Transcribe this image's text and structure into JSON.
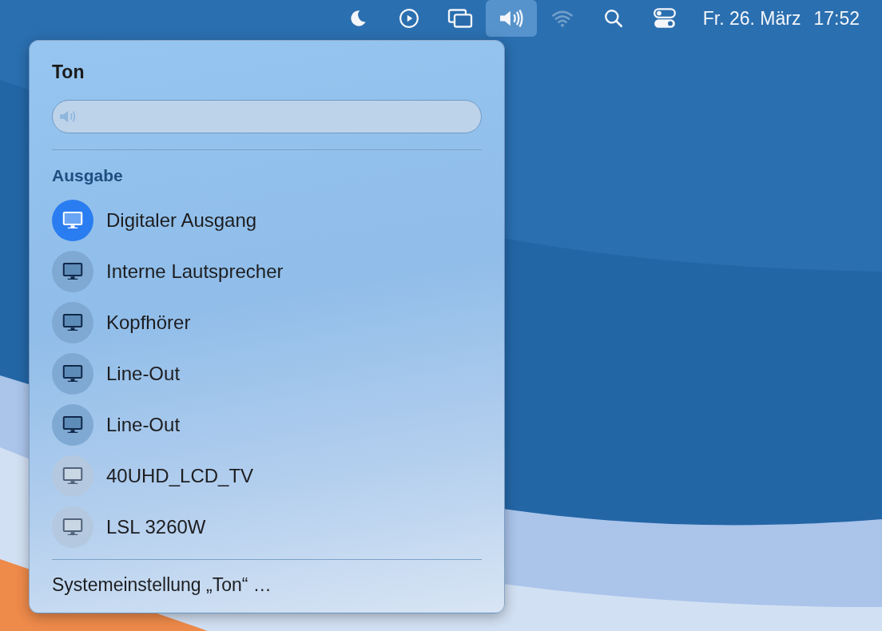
{
  "menu_bar": {
    "items": [
      {
        "kind": "moon",
        "selected": false,
        "disabled": false
      },
      {
        "kind": "play",
        "selected": false,
        "disabled": false
      },
      {
        "kind": "screens",
        "selected": false,
        "disabled": false
      },
      {
        "kind": "speaker",
        "selected": true,
        "disabled": false
      },
      {
        "kind": "wifi",
        "selected": false,
        "disabled": true
      },
      {
        "kind": "search",
        "selected": false,
        "disabled": false
      },
      {
        "kind": "toggles",
        "selected": false,
        "disabled": false
      }
    ],
    "date": "Fr. 26. März",
    "time": "17:52"
  },
  "sound_menu": {
    "title": "Ton",
    "volume": {
      "level": 0
    },
    "section": "Ausgabe",
    "devices": [
      {
        "name": "Digitaler Ausgang",
        "selected": true
      },
      {
        "name": "Interne Lautsprecher",
        "selected": false
      },
      {
        "name": "Kopfhörer",
        "selected": false
      },
      {
        "name": "Line-Out",
        "selected": false
      },
      {
        "name": "Line-Out",
        "selected": false
      },
      {
        "name": "40UHD_LCD_TV",
        "selected": false
      },
      {
        "name": "LSL 3260W",
        "selected": false
      }
    ],
    "footer": "Systemeinstellung „Ton“ …"
  }
}
